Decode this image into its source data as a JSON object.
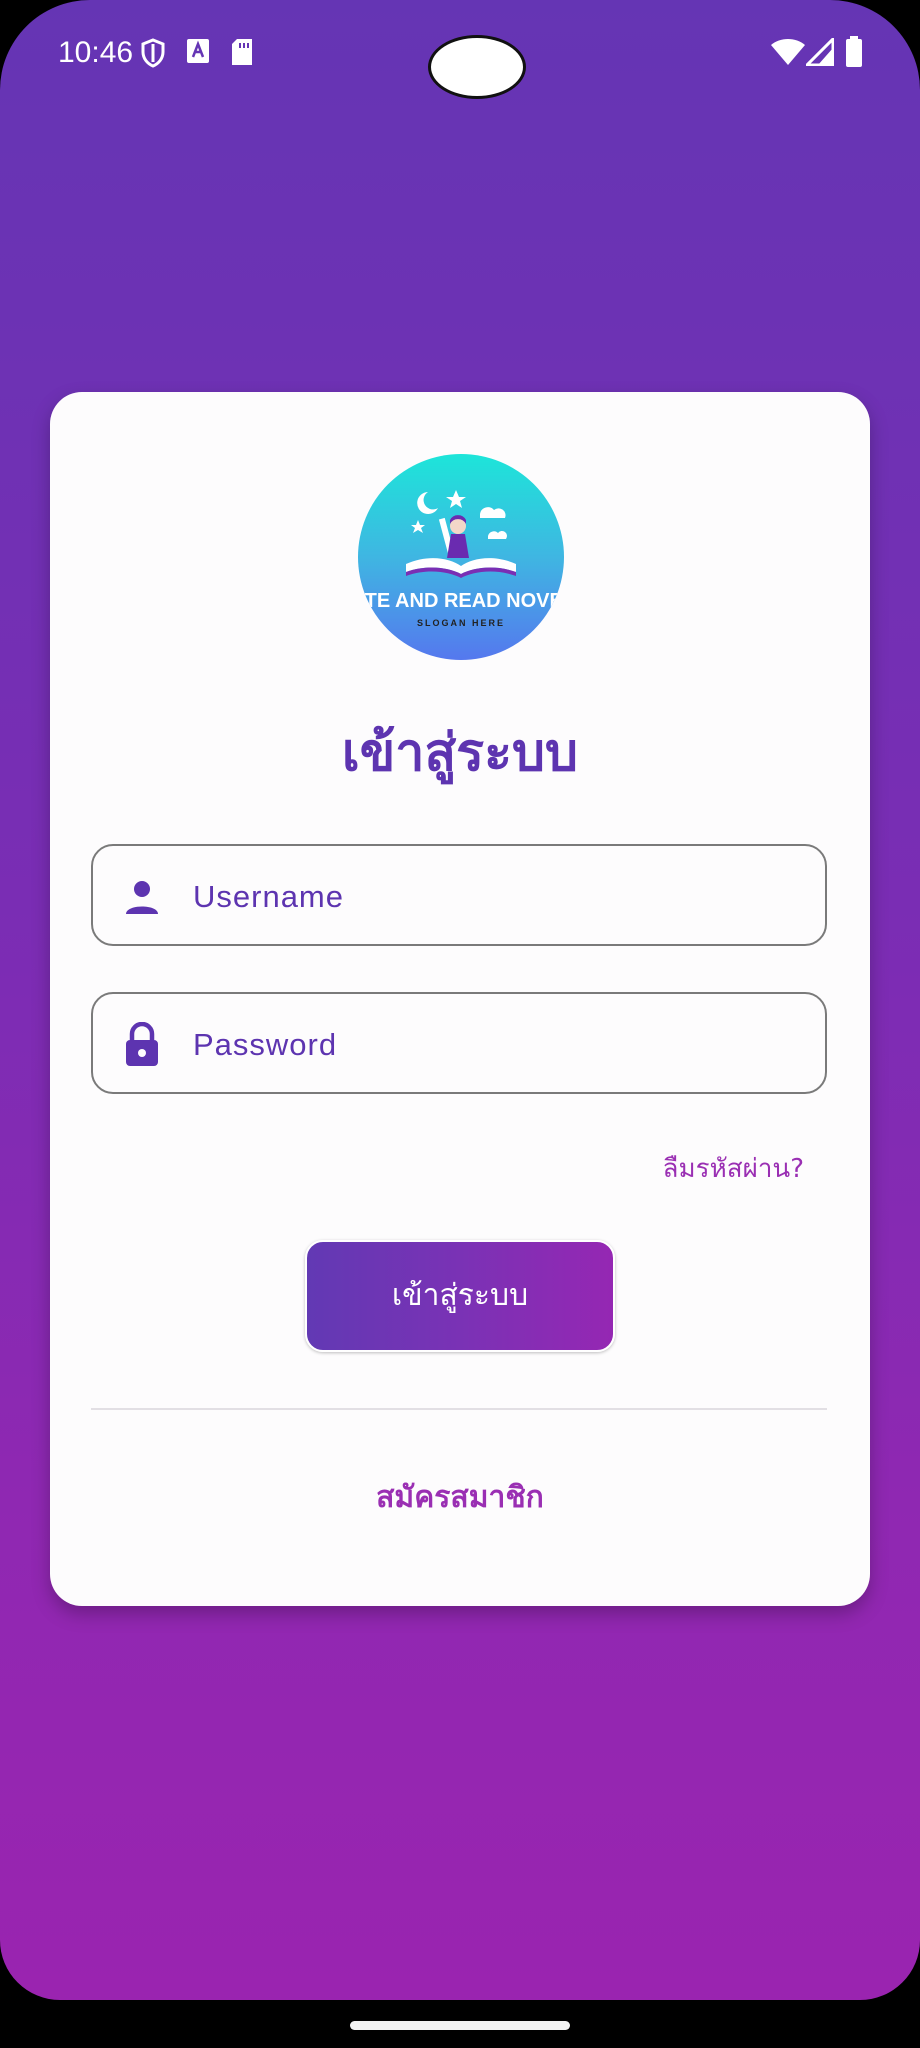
{
  "status_bar": {
    "time": "10:46",
    "left_icons": [
      "shield-icon",
      "font-a-icon",
      "sd-card-icon"
    ],
    "right_icons": [
      "wifi-icon",
      "cell-signal-icon",
      "battery-icon"
    ]
  },
  "logo": {
    "text": "ITE AND READ NOVE",
    "slogan": "SLOGAN HERE"
  },
  "login": {
    "title": "เข้าสู่ระบบ",
    "username_placeholder": "Username",
    "password_placeholder": "Password",
    "forgot_password": "ลืมรหัสผ่าน?",
    "login_button": "เข้าสู่ระบบ",
    "register_link": "สมัครสมาชิก"
  },
  "colors": {
    "primary": "#5d34b0",
    "accent": "#9a2fb3",
    "gradient_top": "#6535b4",
    "gradient_bottom": "#9a24b0"
  }
}
